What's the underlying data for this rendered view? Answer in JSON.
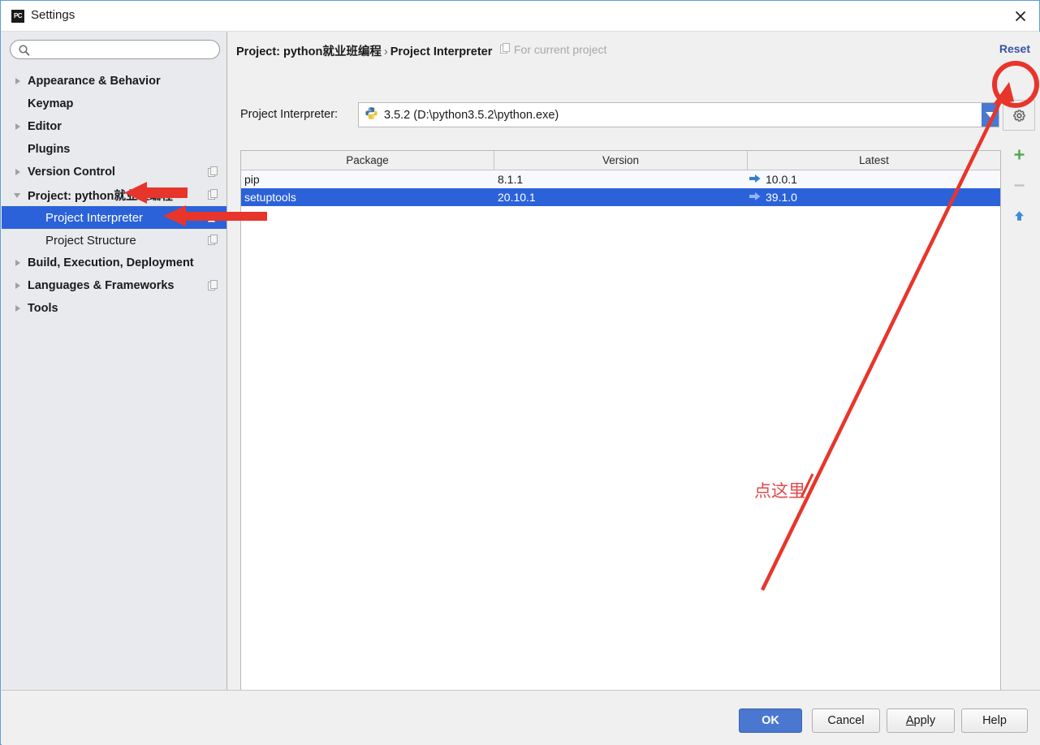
{
  "window": {
    "title": "Settings",
    "icon": "pycharm-icon",
    "close_label": "close-icon"
  },
  "sidebar": {
    "search": {
      "value": "",
      "placeholder": "",
      "icon": "search-icon"
    },
    "items": [
      {
        "label": "Appearance & Behavior",
        "expander": "closed",
        "level": 0,
        "selected": false,
        "copy_icon": false
      },
      {
        "label": "Keymap",
        "expander": "none",
        "level": 0,
        "selected": false,
        "copy_icon": false
      },
      {
        "label": "Editor",
        "expander": "closed",
        "level": 0,
        "selected": false,
        "copy_icon": false
      },
      {
        "label": "Plugins",
        "expander": "none",
        "level": 0,
        "selected": false,
        "copy_icon": false
      },
      {
        "label": "Version Control",
        "expander": "closed",
        "level": 0,
        "selected": false,
        "copy_icon": true
      },
      {
        "label": "Project: python就业班编程",
        "expander": "open",
        "level": 0,
        "selected": false,
        "copy_icon": true
      },
      {
        "label": "Project Interpreter",
        "expander": "none",
        "level": 1,
        "selected": true,
        "copy_icon": true
      },
      {
        "label": "Project Structure",
        "expander": "none",
        "level": 1,
        "selected": false,
        "copy_icon": true
      },
      {
        "label": "Build, Execution, Deployment",
        "expander": "closed",
        "level": 0,
        "selected": false,
        "copy_icon": false
      },
      {
        "label": "Languages & Frameworks",
        "expander": "closed",
        "level": 0,
        "selected": false,
        "copy_icon": true
      },
      {
        "label": "Tools",
        "expander": "closed",
        "level": 0,
        "selected": false,
        "copy_icon": false
      }
    ]
  },
  "header": {
    "breadcrumb_root": "Project: python就业班编程",
    "breadcrumb_sep": "›",
    "breadcrumb_leaf": "Project Interpreter",
    "scope_label": "For current project",
    "scope_icon": "copy-icon",
    "reset_label": "Reset"
  },
  "interpreter": {
    "label": "Project Interpreter:",
    "value": "3.5.2 (D:\\python3.5.2\\python.exe)",
    "icon": "python-icon",
    "dropdown_icon": "chevron-down-icon"
  },
  "tools": {
    "gear": "gear-icon",
    "add": "plus-icon",
    "remove": "minus-icon",
    "upgrade": "arrow-up-icon"
  },
  "packages_table": {
    "columns": [
      "Package",
      "Version",
      "Latest"
    ],
    "rows": [
      {
        "package": "pip",
        "version": "8.1.1",
        "latest": "10.0.1",
        "latest_icon": "arrow-right-icon",
        "selected": false
      },
      {
        "package": "setuptools",
        "version": "20.10.1",
        "latest": "39.1.0",
        "latest_icon": "arrow-right-icon",
        "selected": true
      }
    ]
  },
  "footer": {
    "ok": "OK",
    "cancel": "Cancel",
    "apply_mnemonic": "A",
    "apply_rest": "pply",
    "help": "Help"
  },
  "annotations": {
    "click_here_text": "点这里",
    "color": "#e04a4a"
  },
  "colors": {
    "accent": "#2b62d9",
    "primary_button": "#4a78d0",
    "sidebar_bg": "#e8eaed",
    "annotation_red": "#e04a4a",
    "link": "#3a53a4"
  }
}
